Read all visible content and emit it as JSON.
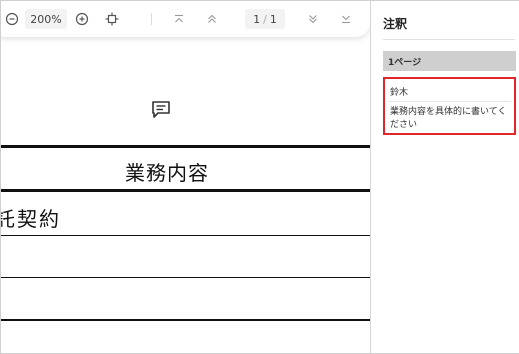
{
  "toolbar": {
    "zoom_out_icon": "minus-circle-icon",
    "zoom_level": "200%",
    "zoom_in_icon": "plus-circle-icon",
    "fit_icon": "fit-page-icon",
    "first_page_icon": "first-page-icon",
    "prev_page_icon": "prev-page-icon",
    "current_page": "1",
    "total_pages": "1",
    "next_page_icon": "next-page-icon",
    "last_page_icon": "last-page-icon"
  },
  "document": {
    "comment_icon": "comment-icon",
    "title": "業務内容",
    "contract_text": "託契約"
  },
  "panel": {
    "title": "注釈",
    "page_label": "1ページ",
    "comment": {
      "author": "鈴木",
      "text": "業務内容を具体的に書いてください"
    }
  },
  "colors": {
    "highlight_border": "#e0262b",
    "page_header_bg": "#cfcfcf"
  }
}
